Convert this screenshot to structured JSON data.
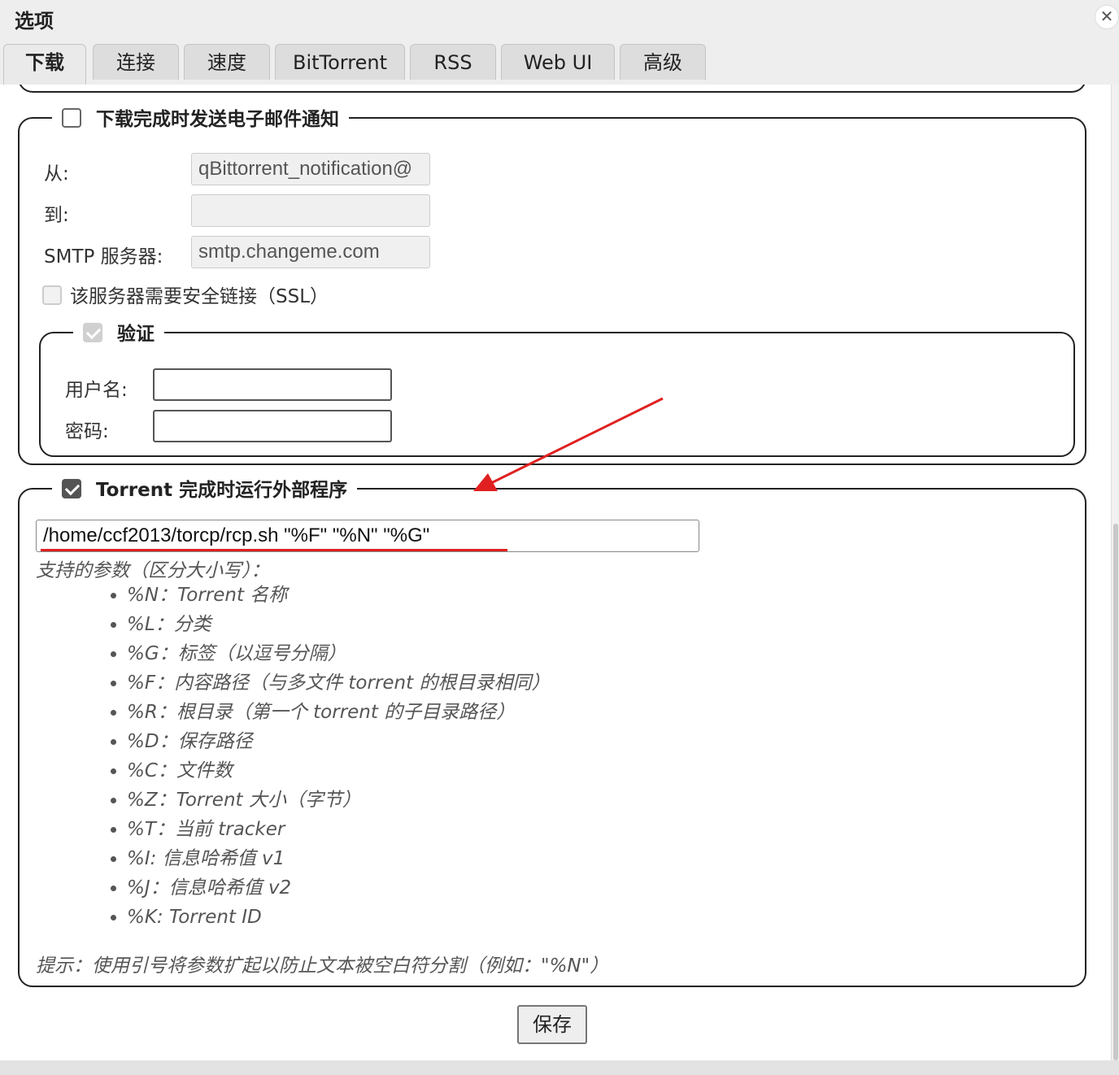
{
  "window": {
    "title": "选项"
  },
  "tabs": [
    {
      "label": "下载",
      "active": true
    },
    {
      "label": "连接"
    },
    {
      "label": "速度"
    },
    {
      "label": "BitTorrent"
    },
    {
      "label": "RSS"
    },
    {
      "label": "Web UI"
    },
    {
      "label": "高级"
    }
  ],
  "email": {
    "legend": "下载完成时发送电子邮件通知",
    "checked": false,
    "from_label": "从:",
    "from_value": "qBittorrent_notification@",
    "to_label": "到:",
    "to_value": "",
    "smtp_label": "SMTP 服务器:",
    "smtp_value": "smtp.changeme.com",
    "ssl_label": "该服务器需要安全链接（SSL）",
    "auth": {
      "legend": "验证",
      "checked": true,
      "username_label": "用户名:",
      "username_value": "",
      "password_label": "密码:",
      "password_value": ""
    }
  },
  "external_program": {
    "legend": "Torrent 完成时运行外部程序",
    "checked": true,
    "command": "/home/ccf2013/torcp/rcp.sh \"%F\"  \"%N\" \"%G\"",
    "supported_params_label": "支持的参数（区分大小写）：",
    "params": [
      "%N：Torrent 名称",
      "%L：分类",
      "%G：标签（以逗号分隔）",
      "%F：内容路径（与多文件 torrent 的根目录相同）",
      "%R：根目录（第一个 torrent 的子目录路径）",
      "%D：保存路径",
      "%C：文件数",
      "%Z：Torrent 大小（字节）",
      "%T：当前 tracker",
      "%I: 信息哈希值 v1",
      "%J：信息哈希值 v2",
      "%K: Torrent ID"
    ],
    "tip": "提示：使用引号将参数扩起以防止文本被空白符分割（例如：\"%N\"）"
  },
  "save_label": "保存",
  "colors": {
    "annotation": "#e02020",
    "tab_bg": "#dddddd",
    "panel_border": "#222222"
  }
}
